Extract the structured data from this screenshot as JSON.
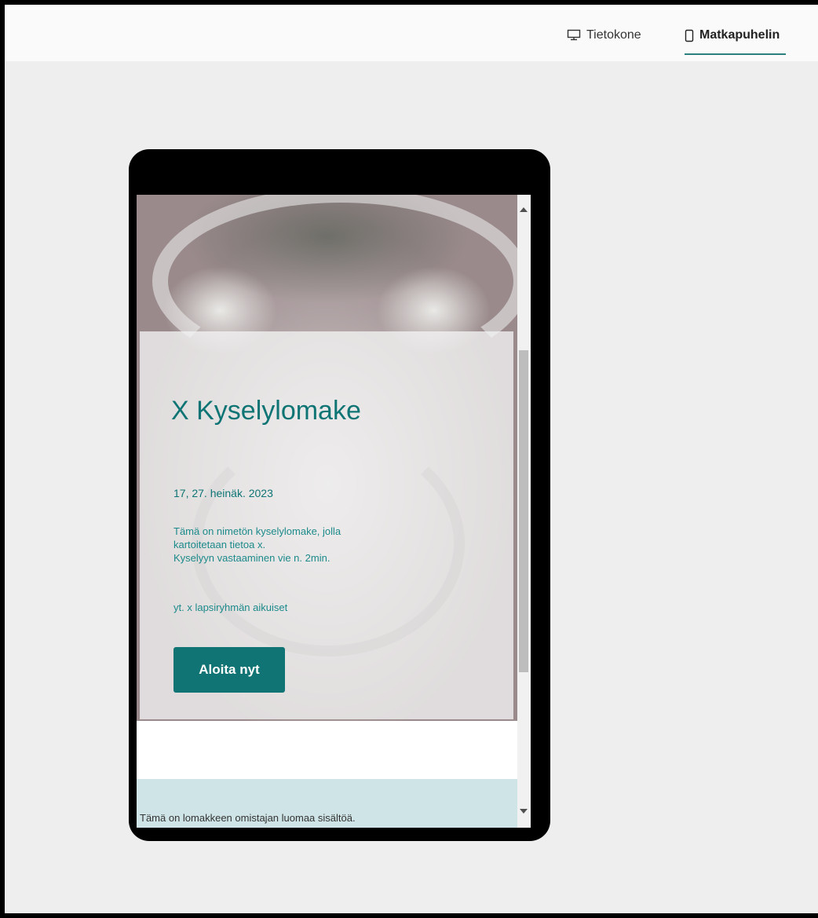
{
  "view_toggle": {
    "desktop_label": "Tietokone",
    "desktop_icon": "monitor-icon",
    "mobile_label": "Matkapuhelin",
    "mobile_icon": "smartphone-icon",
    "selected": "Matkapuhelin"
  },
  "form": {
    "title": "X Kyselylomake",
    "date": "17, 27. heinäk. 2023",
    "description_lines": [
      "Tämä on nimetön kyselylomake, jolla",
      "kartoitetaan tietoa x.",
      "Kyselyyn vastaaminen vie n. 2min."
    ],
    "audience": "yt. x lapsiryhmän aikuiset",
    "start_button": "Aloita nyt",
    "footer_note": "Tämä on lomakkeen omistajan luomaa sisältöä."
  },
  "colors": {
    "accent": "#117474",
    "footer_bg": "#cfe4e6",
    "canvas_bg": "#eeeeee"
  }
}
